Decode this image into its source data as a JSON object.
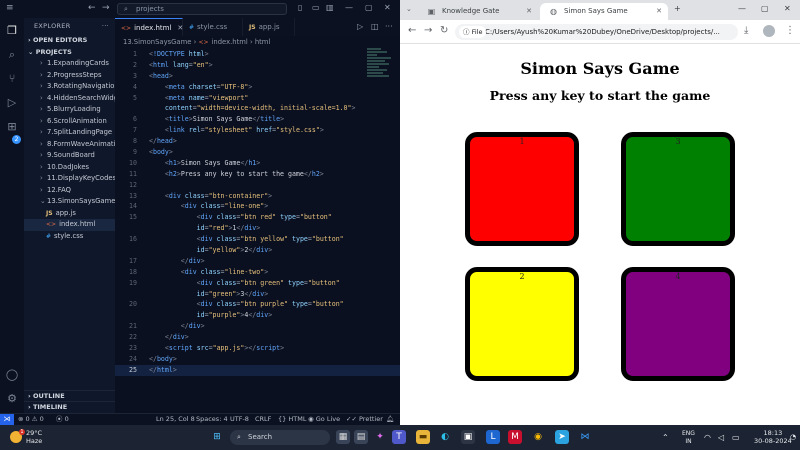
{
  "vscode": {
    "search_text": "projects",
    "explorer_title": "EXPLORER",
    "open_editors_label": "OPEN EDITORS",
    "projects_label": "PROJECTS",
    "folders": [
      "1.ExpandingCards",
      "2.ProgressSteps",
      "3.RotatingNavigation",
      "4.HiddenSearchWidget",
      "5.BlurryLoading",
      "6.ScrollAnimation",
      "7.SplitLandingPage",
      "8.FormWaveAnimation",
      "9.SoundBoard",
      "10.DadJokes",
      "11.DisplayKeyCodes",
      "12.FAQ",
      "13.SimonSaysGame"
    ],
    "files": [
      {
        "name": "app.js",
        "type": "js"
      },
      {
        "name": "index.html",
        "type": "html"
      },
      {
        "name": "style.css",
        "type": "css"
      }
    ],
    "outline_label": "OUTLINE",
    "timeline_label": "TIMELINE",
    "tabs": [
      {
        "label": "index.html",
        "type": "html"
      },
      {
        "label": "style.css",
        "type": "css"
      },
      {
        "label": "app.js",
        "type": "js"
      }
    ],
    "breadcrumb": {
      "folder": "13.SimonSaysGame",
      "file": "index.html",
      "node": "html"
    },
    "code_lines": [
      {
        "n": "1",
        "html": "<span class=\"pt\">&lt;</span><span class=\"tg\">!DOCTYPE</span> <span class=\"at\">html</span><span class=\"pt\">&gt;</span>"
      },
      {
        "n": "2",
        "html": "<span class=\"pt\">&lt;</span><span class=\"tg\">html</span> <span class=\"at\">lang</span>=<span class=\"st\">\"en\"</span><span class=\"pt\">&gt;</span>"
      },
      {
        "n": "3",
        "html": "<span class=\"pt\">&lt;</span><span class=\"tg\">head</span><span class=\"pt\">&gt;</span>"
      },
      {
        "n": "4",
        "html": "    <span class=\"pt\">&lt;</span><span class=\"tg\">meta</span> <span class=\"at\">charset</span>=<span class=\"st\">\"UTF-8\"</span><span class=\"pt\">&gt;</span>"
      },
      {
        "n": "5",
        "html": "    <span class=\"pt\">&lt;</span><span class=\"tg\">meta</span> <span class=\"at\">name</span>=<span class=\"st\">\"viewport\"</span>"
      },
      {
        "n": "",
        "html": "    <span class=\"at\">content</span>=<span class=\"st\">\"width=device-width, initial-scale=1.0\"</span><span class=\"pt\">&gt;</span>"
      },
      {
        "n": "6",
        "html": "    <span class=\"pt\">&lt;</span><span class=\"tg\">title</span><span class=\"pt\">&gt;</span><span class=\"tt\">Simon Says Game</span><span class=\"pt\">&lt;/</span><span class=\"tg\">title</span><span class=\"pt\">&gt;</span>"
      },
      {
        "n": "7",
        "html": "    <span class=\"pt\">&lt;</span><span class=\"tg\">link</span> <span class=\"at\">rel</span>=<span class=\"st\">\"stylesheet\"</span> <span class=\"at\">href</span>=<span class=\"st\">\"style.css\"</span><span class=\"pt\">&gt;</span>"
      },
      {
        "n": "8",
        "html": "<span class=\"pt\">&lt;/</span><span class=\"tg\">head</span><span class=\"pt\">&gt;</span>"
      },
      {
        "n": "9",
        "html": "<span class=\"pt\">&lt;</span><span class=\"tg\">body</span><span class=\"pt\">&gt;</span>"
      },
      {
        "n": "10",
        "html": "    <span class=\"pt\">&lt;</span><span class=\"tg\">h1</span><span class=\"pt\">&gt;</span><span class=\"tt\">Simon Says Game</span><span class=\"pt\">&lt;/</span><span class=\"tg\">h1</span><span class=\"pt\">&gt;</span>"
      },
      {
        "n": "11",
        "html": "    <span class=\"pt\">&lt;</span><span class=\"tg\">h2</span><span class=\"pt\">&gt;</span><span class=\"tt\">Press any key to start the game</span><span class=\"pt\">&lt;/</span><span class=\"tg\">h2</span><span class=\"pt\">&gt;</span>"
      },
      {
        "n": "12",
        "html": ""
      },
      {
        "n": "13",
        "html": "    <span class=\"pt\">&lt;</span><span class=\"tg\">div</span> <span class=\"at\">class</span>=<span class=\"st\">\"btn-container\"</span><span class=\"pt\">&gt;</span>"
      },
      {
        "n": "14",
        "html": "        <span class=\"pt\">&lt;</span><span class=\"tg\">div</span> <span class=\"at\">class</span>=<span class=\"st\">\"line-one\"</span><span class=\"pt\">&gt;</span>"
      },
      {
        "n": "15",
        "html": "            <span class=\"pt\">&lt;</span><span class=\"tg\">div</span> <span class=\"at\">class</span>=<span class=\"st\">\"btn red\"</span> <span class=\"at\">type</span>=<span class=\"st\">\"button\"</span>"
      },
      {
        "n": "",
        "html": "            <span class=\"at\">id</span>=<span class=\"st\">\"red\"</span><span class=\"pt\">&gt;</span><span class=\"tt\">1</span><span class=\"pt\">&lt;/</span><span class=\"tg\">div</span><span class=\"pt\">&gt;</span>"
      },
      {
        "n": "16",
        "html": "            <span class=\"pt\">&lt;</span><span class=\"tg\">div</span> <span class=\"at\">class</span>=<span class=\"st\">\"btn yellow\"</span> <span class=\"at\">type</span>=<span class=\"st\">\"button\"</span>"
      },
      {
        "n": "",
        "html": "            <span class=\"at\">id</span>=<span class=\"st\">\"yellow\"</span><span class=\"pt\">&gt;</span><span class=\"tt\">2</span><span class=\"pt\">&lt;/</span><span class=\"tg\">div</span><span class=\"pt\">&gt;</span>"
      },
      {
        "n": "17",
        "html": "        <span class=\"pt\">&lt;/</span><span class=\"tg\">div</span><span class=\"pt\">&gt;</span>"
      },
      {
        "n": "18",
        "html": "        <span class=\"pt\">&lt;</span><span class=\"tg\">div</span> <span class=\"at\">class</span>=<span class=\"st\">\"line-two\"</span><span class=\"pt\">&gt;</span>"
      },
      {
        "n": "19",
        "html": "            <span class=\"pt\">&lt;</span><span class=\"tg\">div</span> <span class=\"at\">class</span>=<span class=\"st\">\"btn green\"</span> <span class=\"at\">type</span>=<span class=\"st\">\"button\"</span>"
      },
      {
        "n": "",
        "html": "            <span class=\"at\">id</span>=<span class=\"st\">\"green\"</span><span class=\"pt\">&gt;</span><span class=\"tt\">3</span><span class=\"pt\">&lt;/</span><span class=\"tg\">div</span><span class=\"pt\">&gt;</span>"
      },
      {
        "n": "20",
        "html": "            <span class=\"pt\">&lt;</span><span class=\"tg\">div</span> <span class=\"at\">class</span>=<span class=\"st\">\"btn purple\"</span> <span class=\"at\">type</span>=<span class=\"st\">\"button\"</span>"
      },
      {
        "n": "",
        "html": "            <span class=\"at\">id</span>=<span class=\"st\">\"purple\"</span><span class=\"pt\">&gt;</span><span class=\"tt\">4</span><span class=\"pt\">&lt;/</span><span class=\"tg\">div</span><span class=\"pt\">&gt;</span>"
      },
      {
        "n": "21",
        "html": "        <span class=\"pt\">&lt;/</span><span class=\"tg\">div</span><span class=\"pt\">&gt;</span>"
      },
      {
        "n": "22",
        "html": "    <span class=\"pt\">&lt;/</span><span class=\"tg\">div</span><span class=\"pt\">&gt;</span>"
      },
      {
        "n": "23",
        "html": "    <span class=\"pt\">&lt;</span><span class=\"tg\">script</span> <span class=\"at\">src</span>=<span class=\"st\">\"app.js\"</span><span class=\"pt\">&gt;&lt;/</span><span class=\"tg\">script</span><span class=\"pt\">&gt;</span>"
      },
      {
        "n": "24",
        "html": "<span class=\"pt\">&lt;/</span><span class=\"tg\">body</span><span class=\"pt\">&gt;</span>"
      },
      {
        "n": "25",
        "html": "<span class=\"pt\">&lt;/</span><span class=\"tg\">html</span><span class=\"pt\">&gt;</span>",
        "current": true
      }
    ],
    "status": {
      "errors": "0",
      "warnings": "0",
      "ports": "0",
      "position": "Ln 25, Col 8",
      "spaces": "Spaces: 4",
      "encoding": "UTF-8",
      "eol": "CRLF",
      "language": "HTML",
      "go_live": "Go Live",
      "prettier": "Prettier"
    },
    "colors": {
      "accent": "#3b82f6",
      "background": "#0b1120"
    }
  },
  "browser": {
    "tabs": [
      {
        "title": "Knowledge Gate",
        "active": false
      },
      {
        "title": "Simon Says Game",
        "active": true
      }
    ],
    "new_tab": "+",
    "site_chip": "File",
    "url": "C:/Users/Ayush%20Kumar%20Dubey/OneDrive/Desktop/projects/...",
    "page": {
      "title": "Simon Says Game",
      "subtitle": "Press any key to start the game",
      "buttons": [
        {
          "id": "red",
          "label": "1",
          "color": "#ff0000"
        },
        {
          "id": "green",
          "label": "3",
          "color": "#008000"
        },
        {
          "id": "yellow",
          "label": "2",
          "color": "#ffff00"
        },
        {
          "id": "purple",
          "label": "4",
          "color": "#800080"
        }
      ]
    }
  },
  "taskbar": {
    "temperature": "29°C",
    "condition": "Haze",
    "weather_badge": "1",
    "search_placeholder": "Search",
    "lang_top": "ENG",
    "lang_bottom": "IN",
    "time": "18:13",
    "date": "30-08-2024"
  }
}
